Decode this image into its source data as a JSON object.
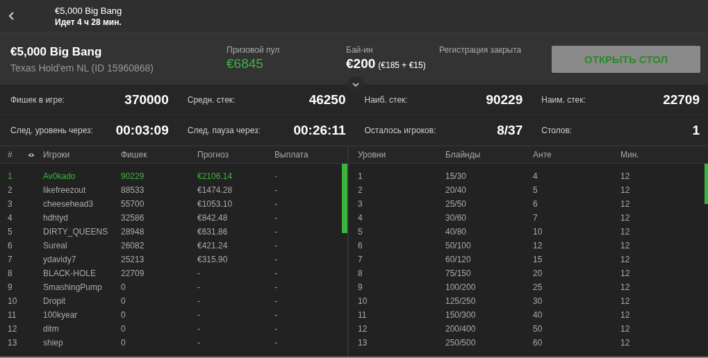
{
  "top_bar": {
    "title": "€5,000 Big Bang",
    "subtitle": "Идет 4 ч 28 мин."
  },
  "header": {
    "title": "€5,000 Big Bang",
    "subtitle": "Texas Hold'em NL (ID 15960868)",
    "prize_pool": {
      "label": "Призовой пул",
      "value": "€6845"
    },
    "buy_in": {
      "label": "Бай-ин",
      "value": "€200",
      "detail": "(€185 + €15)"
    },
    "registration": "Регистрация закрыта",
    "button": {
      "label": "ОТКРЫТЬ СТОЛ",
      "disabled": true
    }
  },
  "stats": [
    {
      "label": "Фишек в игре:",
      "value": "370000"
    },
    {
      "label": "Средн. стек:",
      "value": "46250"
    },
    {
      "label": "Наиб. стек:",
      "value": "90229"
    },
    {
      "label": "Наим. стек:",
      "value": "22709"
    },
    {
      "label": "След. уровень через:",
      "value": "00:03:09"
    },
    {
      "label": "След. пауза через:",
      "value": "00:26:11"
    },
    {
      "label": "Осталось игроков:",
      "value": "8/37"
    },
    {
      "label": "Столов:",
      "value": "1"
    }
  ],
  "players": {
    "columns": [
      "#",
      "Игроки",
      "Фишек",
      "Прогноз",
      "Выплата"
    ],
    "rows": [
      {
        "cells": [
          "1",
          "Av0kado",
          "90229",
          "€2106.14",
          "-"
        ],
        "highlighted": true
      },
      {
        "cells": [
          "2",
          "likefreezout",
          "88533",
          "€1474.28",
          "-"
        ],
        "highlighted": false
      },
      {
        "cells": [
          "3",
          "cheesehead3",
          "55700",
          "€1053.10",
          "-"
        ],
        "highlighted": false
      },
      {
        "cells": [
          "4",
          "hdhtyd",
          "32586",
          "€842.48",
          "-"
        ],
        "highlighted": false
      },
      {
        "cells": [
          "5",
          "DIRTY_QUEENS",
          "28948",
          "€631.86",
          "-"
        ],
        "highlighted": false
      },
      {
        "cells": [
          "6",
          "Sureal",
          "26082",
          "€421.24",
          "-"
        ],
        "highlighted": false
      },
      {
        "cells": [
          "7",
          "ydavidy7",
          "25213",
          "€315.90",
          "-"
        ],
        "highlighted": false
      },
      {
        "cells": [
          "8",
          "BLACK-HOLE",
          "22709",
          "-",
          "-"
        ],
        "highlighted": false
      },
      {
        "cells": [
          "9",
          "SmashingPump",
          "0",
          "-",
          "-"
        ],
        "highlighted": false
      },
      {
        "cells": [
          "10",
          "Dropit",
          "0",
          "-",
          "-"
        ],
        "highlighted": false
      },
      {
        "cells": [
          "11",
          "100kyear",
          "0",
          "-",
          "-"
        ],
        "highlighted": false
      },
      {
        "cells": [
          "12",
          "ditm",
          "0",
          "-",
          "-"
        ],
        "highlighted": false
      },
      {
        "cells": [
          "13",
          "shiep",
          "0",
          "-",
          "-"
        ],
        "highlighted": false
      }
    ]
  },
  "levels": {
    "columns": [
      "Уровни",
      "Блайнды",
      "Анте",
      "Мин."
    ],
    "rows": [
      [
        "1",
        "15/30",
        "4",
        "12"
      ],
      [
        "2",
        "20/40",
        "5",
        "12"
      ],
      [
        "3",
        "25/50",
        "6",
        "12"
      ],
      [
        "4",
        "30/60",
        "7",
        "12"
      ],
      [
        "5",
        "40/80",
        "10",
        "12"
      ],
      [
        "6",
        "50/100",
        "12",
        "12"
      ],
      [
        "7",
        "60/120",
        "15",
        "12"
      ],
      [
        "8",
        "75/150",
        "20",
        "12"
      ],
      [
        "9",
        "100/200",
        "25",
        "12"
      ],
      [
        "10",
        "125/250",
        "30",
        "12"
      ],
      [
        "11",
        "150/300",
        "40",
        "12"
      ],
      [
        "12",
        "200/400",
        "50",
        "12"
      ],
      [
        "13",
        "250/500",
        "60",
        "12"
      ]
    ]
  }
}
